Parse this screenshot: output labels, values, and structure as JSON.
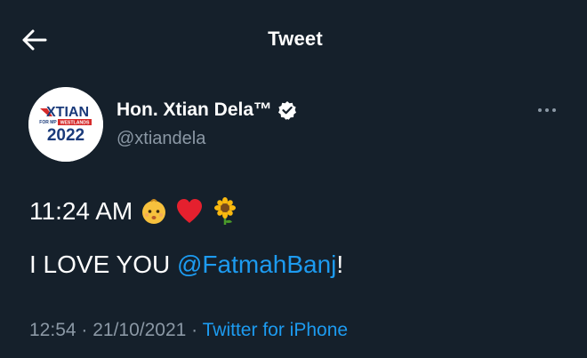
{
  "header": {
    "title": "Tweet",
    "back_icon": "arrow-left-icon"
  },
  "author": {
    "display_name": "Hon. Xtian Dela™",
    "handle": "@xtiandela",
    "verified_icon": "verified-badge-icon",
    "avatar": {
      "line1": "XTIAN",
      "line2a": "FOR MP",
      "line2b": "WESTLANDS",
      "line3": "2022"
    }
  },
  "more_icon": "more-options-icon",
  "tweet": {
    "line1_text": "11:24 AM",
    "line1_emojis": [
      "baby-emoji",
      "red-heart-emoji",
      "sunflower-emoji"
    ],
    "line2_prefix": "I LOVE YOU ",
    "line2_mention": "@FatmahBanj",
    "line2_suffix": "!"
  },
  "meta": {
    "time": "12:54",
    "sep1": " · ",
    "date": "21/10/2021",
    "sep2": " · ",
    "source": "Twitter for iPhone"
  },
  "colors": {
    "background": "#15202b",
    "accent": "#1d9bf0",
    "muted": "#8b98a5",
    "brand_red": "#d62b2b",
    "brand_navy": "#1a3a7a"
  }
}
